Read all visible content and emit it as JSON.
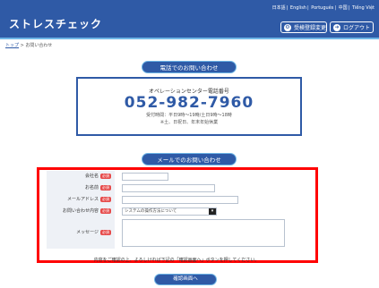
{
  "header": {
    "title": "ストレスチェック",
    "languages": [
      "日本語",
      "English",
      "Português",
      "中国",
      "Tiếng Việt"
    ],
    "buttons": {
      "register": "受検登録変更",
      "logout": "ログアウト"
    }
  },
  "breadcrumb": {
    "home": "トップ",
    "sep": ">",
    "current": "お問い合わせ"
  },
  "phone_section": {
    "heading": "電話でのお問い合わせ",
    "center_name": "オペレーションセンター電話番号",
    "number": "052-982-7960",
    "hours": "受付時間：平日9時〜19時/土日9時〜18時",
    "closed": "※土、日祝日、年末年始休業"
  },
  "mail_section": {
    "heading": "メールでのお問い合わせ"
  },
  "form": {
    "required_badge": "必須",
    "fields": {
      "company": "会社名",
      "name": "お名前",
      "email": "メールアドレス",
      "category": "お問い合わせ内容",
      "message": "メッセージ"
    },
    "category_selected": "システムの操作方法について"
  },
  "note": "内容をご確認の上、よろしければ下記の「確認画面へ」ボタンを押してください。",
  "confirm_button": "確認画面へ"
}
